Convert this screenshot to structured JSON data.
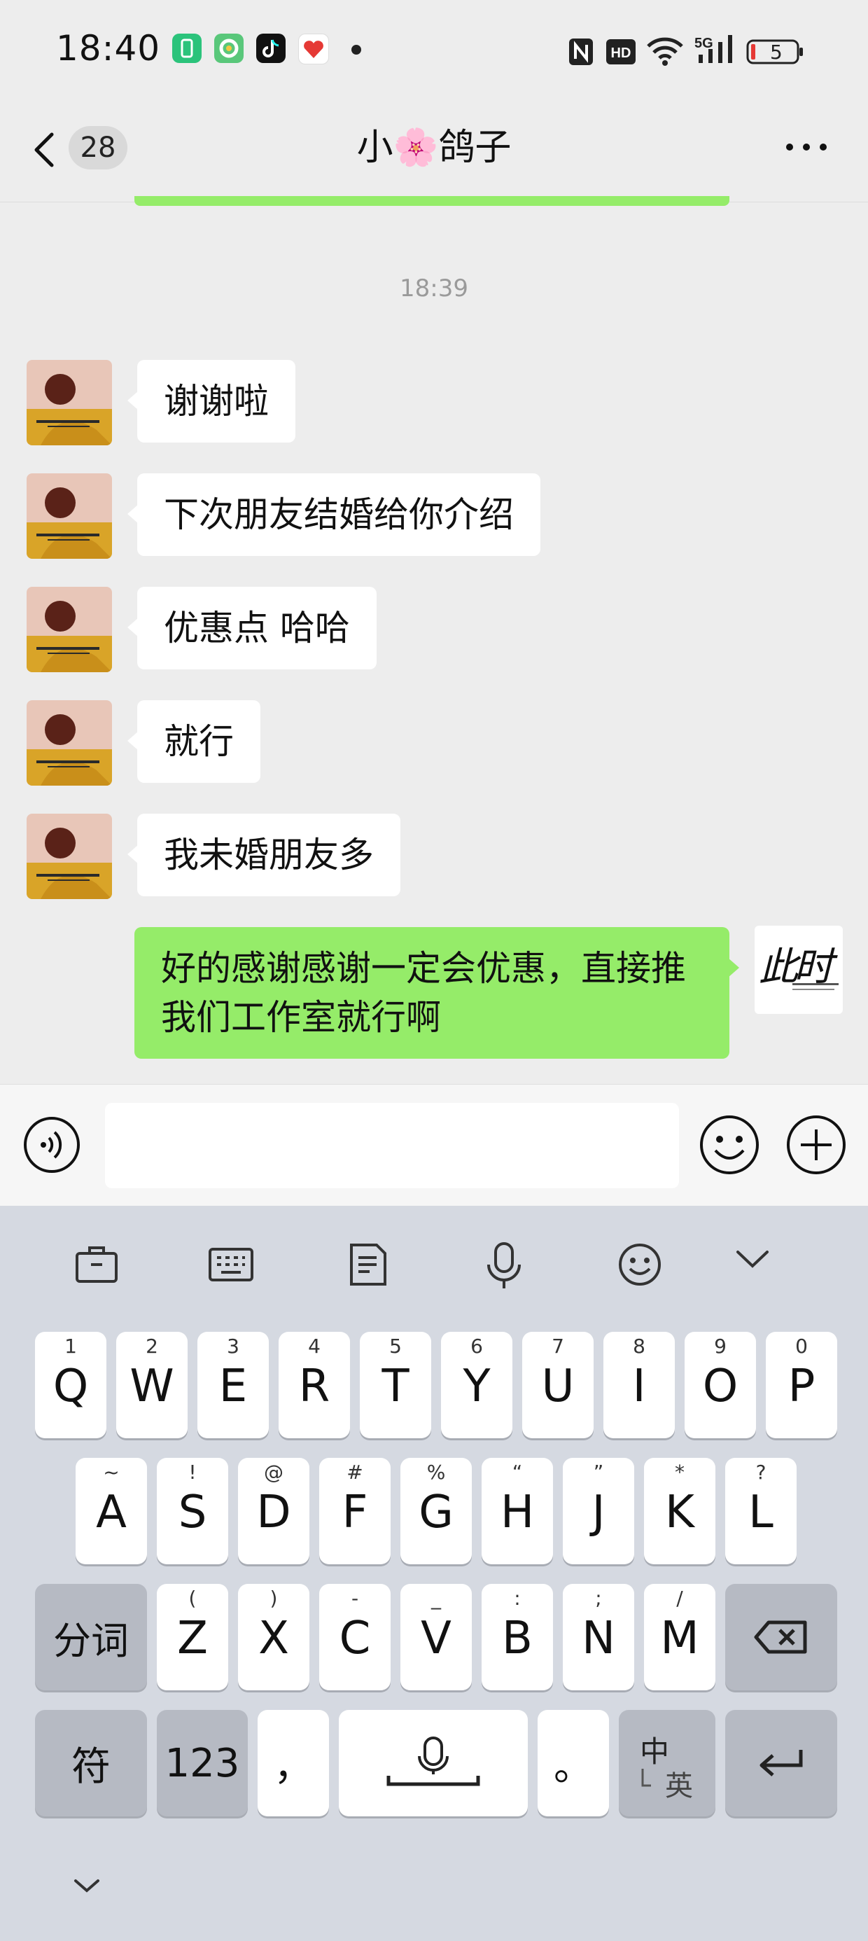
{
  "status_bar": {
    "time": "18:40",
    "battery_level": "5",
    "network": "5G",
    "icons": [
      "phone-manager-app-icon",
      "circle-app-icon",
      "tiktok-app-icon",
      "red-heart-app-icon",
      "notification-dot-icon",
      "nfc-icon",
      "hd-icon",
      "wifi-icon",
      "signal-5g-icon",
      "battery-icon"
    ]
  },
  "header": {
    "unread_count": "28",
    "title": "小🌸鸽子",
    "more_icon": "more-dots-icon",
    "back_icon": "back-chevron-icon"
  },
  "chat": {
    "timestamp": "18:39",
    "incoming": [
      {
        "text": "谢谢啦"
      },
      {
        "text": "下次朋友结婚给你介绍"
      },
      {
        "text": "优惠点 哈哈"
      },
      {
        "text": "就行"
      },
      {
        "text": "我未婚朋友多"
      }
    ],
    "outgoing": [
      {
        "line1": "好的感谢感谢一定会优惠，直接推",
        "line2": "我们工作室就行啊"
      }
    ],
    "my_avatar_text": "此时"
  },
  "input_bar": {
    "input_value": "",
    "voice_icon": "voice-input-icon",
    "emoji_icon": "emoji-icon",
    "plus_icon": "plus-icon"
  },
  "keyboard": {
    "toolbar": [
      "clipboard-icon",
      "keyboard-icon",
      "document-icon",
      "microphone-icon",
      "emoji-face-icon",
      "collapse-chevron-icon"
    ],
    "row1": [
      {
        "sub": "1",
        "key": "Q"
      },
      {
        "sub": "2",
        "key": "W"
      },
      {
        "sub": "3",
        "key": "E"
      },
      {
        "sub": "4",
        "key": "R"
      },
      {
        "sub": "5",
        "key": "T"
      },
      {
        "sub": "6",
        "key": "Y"
      },
      {
        "sub": "7",
        "key": "U"
      },
      {
        "sub": "8",
        "key": "I"
      },
      {
        "sub": "9",
        "key": "O"
      },
      {
        "sub": "0",
        "key": "P"
      }
    ],
    "row2": [
      {
        "sub": "~",
        "key": "A"
      },
      {
        "sub": "!",
        "key": "S"
      },
      {
        "sub": "@",
        "key": "D"
      },
      {
        "sub": "#",
        "key": "F"
      },
      {
        "sub": "%",
        "key": "G"
      },
      {
        "sub": "“",
        "key": "H"
      },
      {
        "sub": "”",
        "key": "J"
      },
      {
        "sub": "*",
        "key": "K"
      },
      {
        "sub": "?",
        "key": "L"
      }
    ],
    "row3": [
      {
        "sub": "(",
        "key": "Z"
      },
      {
        "sub": ")",
        "key": "X"
      },
      {
        "sub": "-",
        "key": "C"
      },
      {
        "sub": "_",
        "key": "V"
      },
      {
        "sub": ":",
        "key": "B"
      },
      {
        "sub": ";",
        "key": "N"
      },
      {
        "sub": "/",
        "key": "M"
      }
    ],
    "fenci_label": "分词",
    "symbol_label": "符",
    "numbers_label": "123",
    "comma_label": "，",
    "period_label": "。",
    "lang_zh": "中",
    "lang_en": "英",
    "hide_icon": "hide-keyboard-chevron-icon"
  }
}
